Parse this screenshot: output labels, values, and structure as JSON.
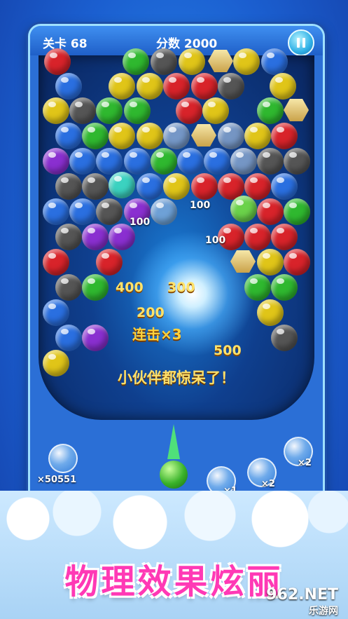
{
  "hud": {
    "level": "关卡 68",
    "score": "分数 2000"
  },
  "popups": {
    "p1": "100",
    "p2": "100",
    "p3": "100",
    "p4": "400",
    "p5": "300",
    "p6": "200",
    "p7": "500"
  },
  "combo": "连击×3",
  "message": "小伙伴都惊呆了！",
  "powerups": {
    "coins": "×50551",
    "x1": "×1",
    "x2a": "×2",
    "x2b": "×2"
  },
  "slogan": "物理效果炫丽",
  "watermark": {
    "top": "962.NET",
    "bottom": "乐游网"
  }
}
